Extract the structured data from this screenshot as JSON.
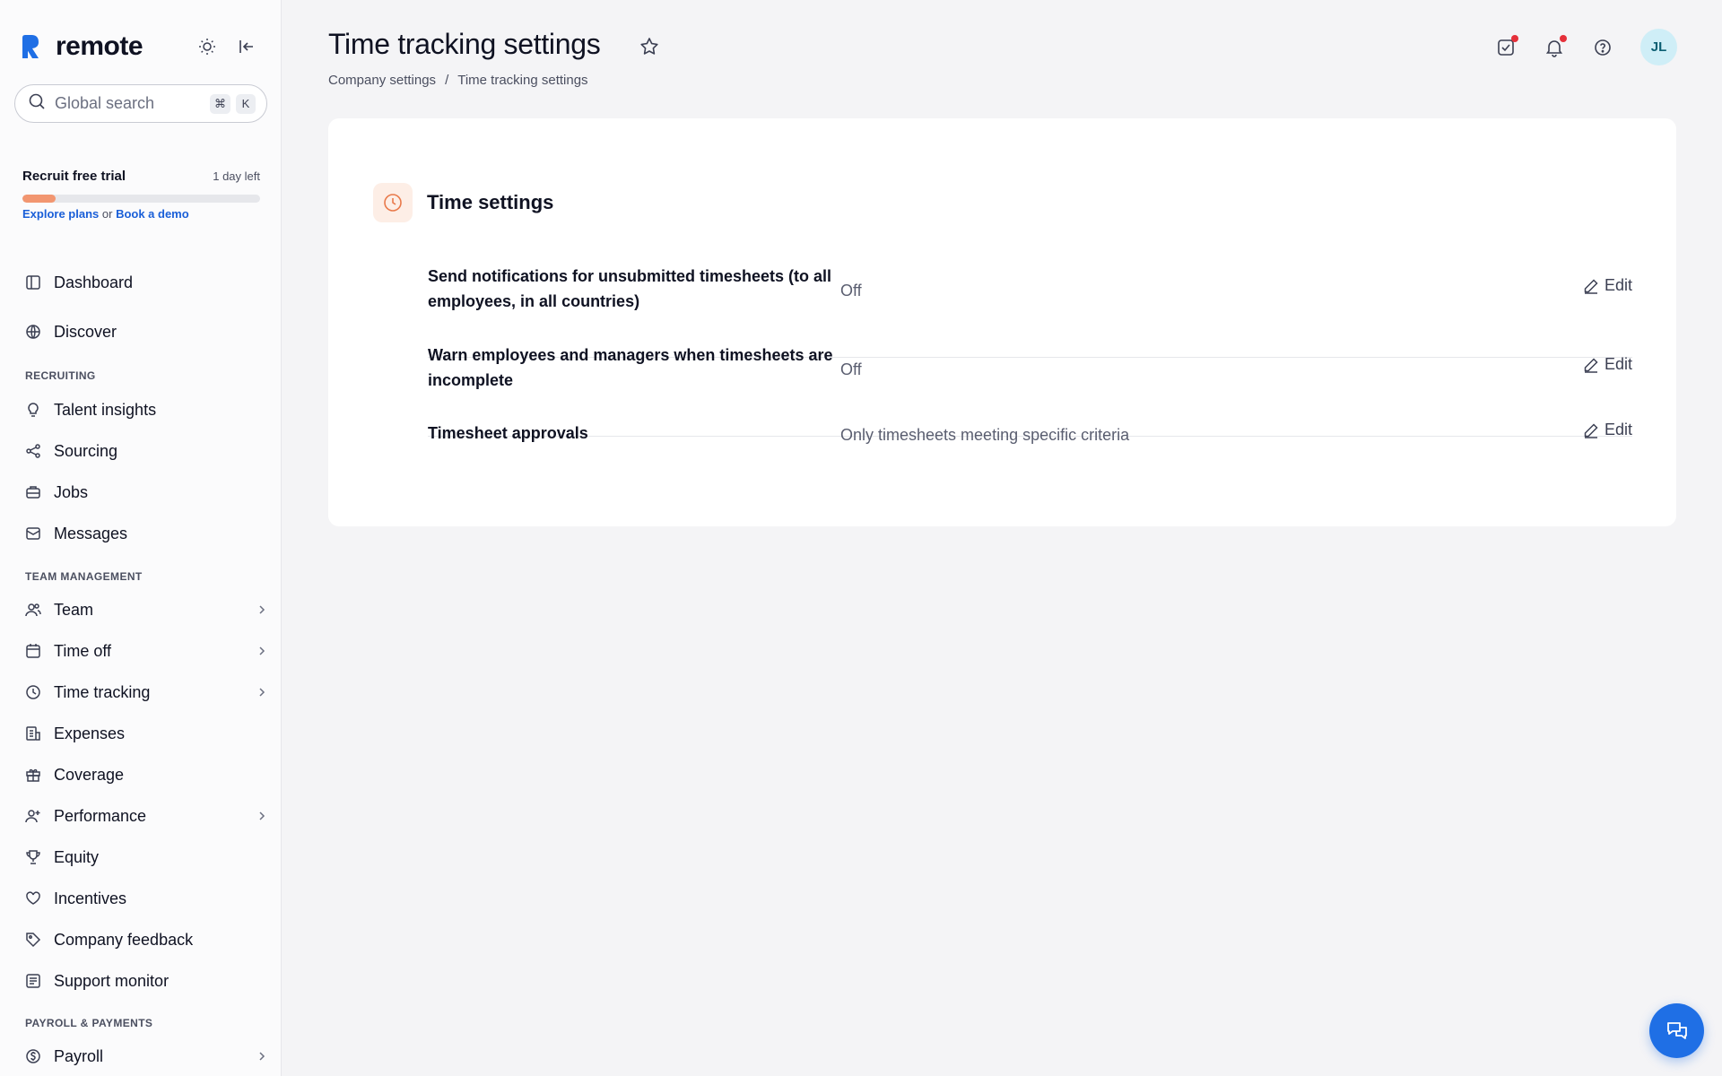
{
  "app": {
    "logo_text": "remote",
    "search_placeholder": "Global search",
    "search_keys": [
      "⌘",
      "K"
    ]
  },
  "trial": {
    "title": "Recruit free trial",
    "remaining": "1 day left",
    "progress_fraction": 0.14,
    "link_plans": "Explore plans",
    "link_or": "or",
    "link_demo": "Book a demo"
  },
  "nav": {
    "dashboard": "Dashboard",
    "discover": "Discover",
    "section_recruiting": "RECRUITING",
    "talent_insights": "Talent insights",
    "sourcing": "Sourcing",
    "jobs": "Jobs",
    "messages": "Messages",
    "section_team": "TEAM MANAGEMENT",
    "team": "Team",
    "time_off": "Time off",
    "time_tracking": "Time tracking",
    "expenses": "Expenses",
    "coverage": "Coverage",
    "performance": "Performance",
    "equity": "Equity",
    "incentives": "Incentives",
    "company_feedback": "Company feedback",
    "support_monitor": "Support monitor",
    "section_payroll": "PAYROLL & PAYMENTS",
    "payroll": "Payroll"
  },
  "header": {
    "title": "Time tracking settings",
    "breadcrumb_parent": "Company settings",
    "breadcrumb_sep": "/",
    "breadcrumb_current": "Time tracking settings",
    "avatar_initials": "JL"
  },
  "card": {
    "title": "Time settings",
    "edit_label": "Edit",
    "rows": [
      {
        "label": "Send notifications for unsubmitted timesheets (to all employees, in all countries)",
        "value": "Off"
      },
      {
        "label": "Warn employees and managers when timesheets are incomplete",
        "value": "Off"
      },
      {
        "label": "Timesheet approvals",
        "value": "Only timesheets meeting specific criteria"
      }
    ]
  },
  "colors": {
    "accent": "#1f6fe5",
    "trial_progress": "#f29670",
    "notification_dot": "#e5303a"
  }
}
